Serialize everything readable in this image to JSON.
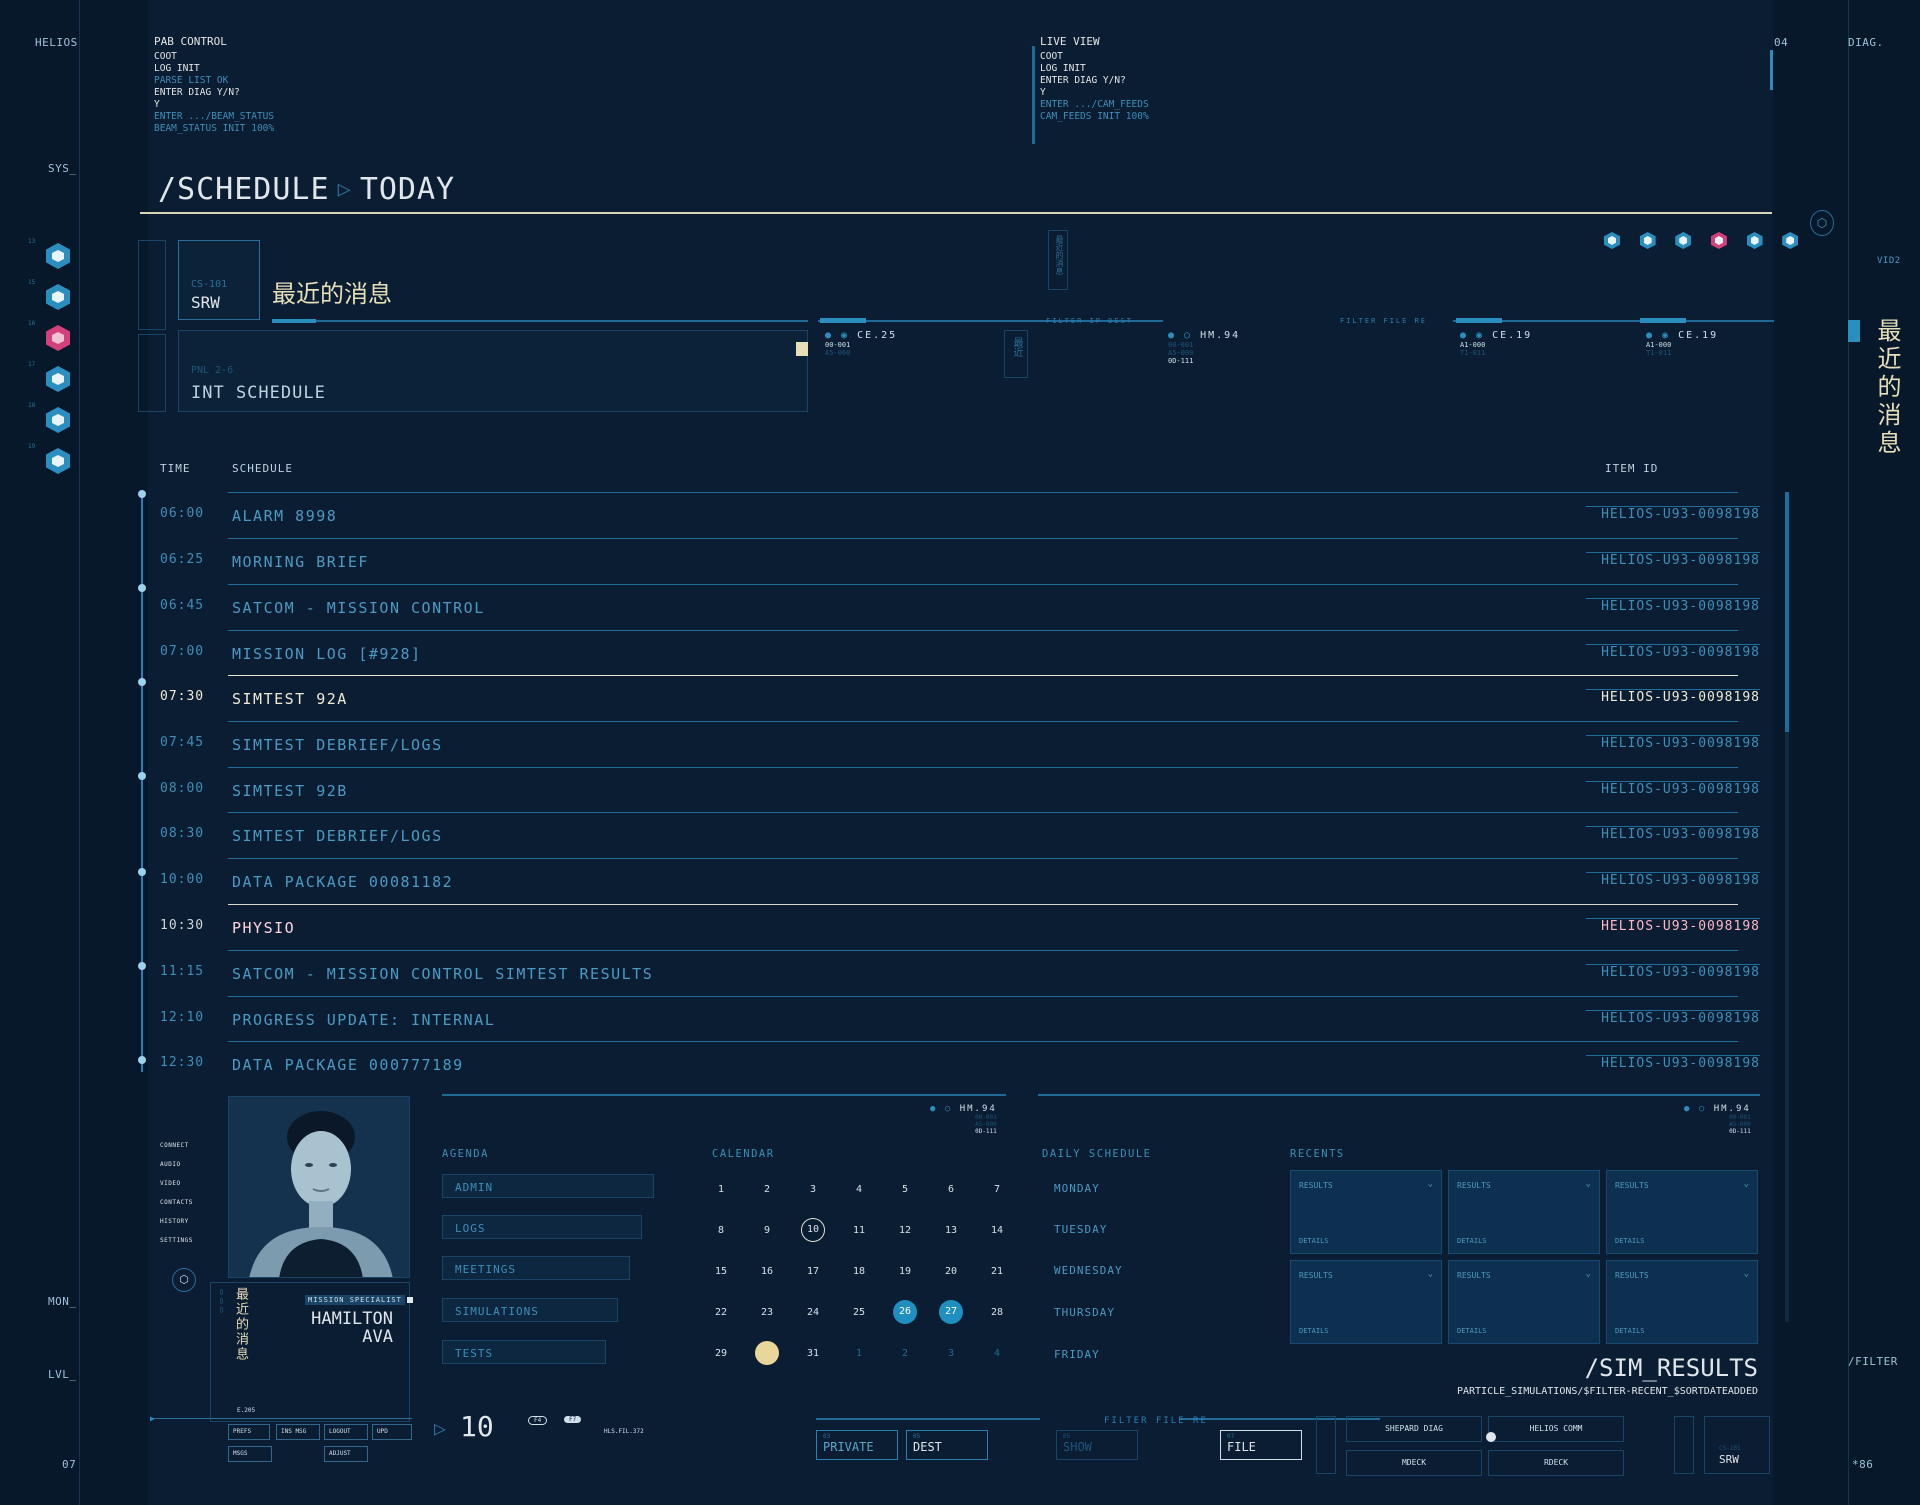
{
  "left_rail": {
    "brand": "HELIOS",
    "sys": "SYS_",
    "hex_nums": [
      "13",
      "15",
      "16",
      "17",
      "18",
      "19"
    ],
    "mon": "MON_",
    "lvl": "LVL_",
    "bottom": "07"
  },
  "right_rail": {
    "top_num": "04",
    "diag": "DIAG.",
    "vid": "VID2",
    "chinese": "最近的消息",
    "filter": "/FILTER",
    "bottom": "*86"
  },
  "terminal_left": {
    "title": "PAB CONTROL",
    "lines": [
      "COOT",
      "LOG INIT"
    ],
    "dim1": "PARSE LIST OK",
    "prompt": "ENTER DIAG Y/N?",
    "answer": "Y",
    "dim2": "ENTER .../BEAM_STATUS",
    "dim3": "BEAM_STATUS INIT 100%"
  },
  "terminal_right": {
    "title": "LIVE VIEW",
    "lines": [
      "COOT",
      "LOG INIT"
    ],
    "prompt": "ENTER DIAG Y/N?",
    "answer": "Y",
    "dim1": "ENTER .../CAM_FEEDS",
    "dim2": "CAM_FEEDS INIT 100%"
  },
  "header": {
    "title": "/SCHEDULE",
    "subtitle": "TODAY"
  },
  "card_srw": {
    "code": "CS-101",
    "name": "SRW",
    "message_title": "最近的消息"
  },
  "card_int": {
    "code": "PNL 2-6",
    "name": "INT SCHEDULE"
  },
  "vert_tags": {
    "tag_a": "最近的消息",
    "tag_b": "最近"
  },
  "status_blocks": [
    {
      "label": "CE.25",
      "l1": "00-001",
      "l2": "A5-000"
    },
    {
      "label": "HM.94",
      "l1": "00-001",
      "l2": "A5-000",
      "l3": "0D-111"
    },
    {
      "label": "CE.19",
      "l1": "A1-000",
      "l2": "T1-011"
    },
    {
      "label": "CE.19",
      "l1": "A1-000",
      "l2": "T1-011"
    }
  ],
  "filters": {
    "ip": "FILTER IP DEST",
    "file": "FILTER FILE RE"
  },
  "table": {
    "col_time": "TIME",
    "col_schedule": "SCHEDULE",
    "col_id": "ITEM ID",
    "rows": [
      {
        "time": "06:00",
        "name": "ALARM 8998",
        "id": "HELIOS-U93-0098198"
      },
      {
        "time": "06:25",
        "name": "MORNING BRIEF",
        "id": "HELIOS-U93-0098198"
      },
      {
        "time": "06:45",
        "name": "SATCOM - MISSION CONTROL",
        "id": "HELIOS-U93-0098198"
      },
      {
        "time": "07:00",
        "name": "MISSION LOG [#928]",
        "id": "HELIOS-U93-0098198"
      },
      {
        "time": "07:30",
        "name": "SIMTEST 92A",
        "id": "HELIOS-U93-0098198"
      },
      {
        "time": "07:45",
        "name": "SIMTEST DEBRIEF/LOGS",
        "id": "HELIOS-U93-0098198"
      },
      {
        "time": "08:00",
        "name": "SIMTEST 92B",
        "id": "HELIOS-U93-0098198"
      },
      {
        "time": "08:30",
        "name": "SIMTEST DEBRIEF/LOGS",
        "id": "HELIOS-U93-0098198"
      },
      {
        "time": "10:00",
        "name": "DATA PACKAGE 00081182",
        "id": "HELIOS-U93-0098198"
      },
      {
        "time": "10:30",
        "name": "PHYSIO",
        "id": "HELIOS-U93-0098198"
      },
      {
        "time": "11:15",
        "name": "SATCOM - MISSION CONTROL SIMTEST RESULTS",
        "id": "HELIOS-U93-0098198"
      },
      {
        "time": "12:10",
        "name": "PROGRESS UPDATE:  INTERNAL",
        "id": "HELIOS-U93-0098198"
      },
      {
        "time": "12:30",
        "name": "DATA PACKAGE 000777189",
        "id": "HELIOS-U93-0098198"
      }
    ]
  },
  "profile": {
    "menu": [
      "CONNECT",
      "AUDIO",
      "VIDEO",
      "CONTACTS",
      "HISTORY",
      "SETTINGS"
    ],
    "role": "MISSION SPECIALIST",
    "last_name": "HAMILTON",
    "first_name": "AVA",
    "chinese": "最近的消息",
    "code": "E.205",
    "buttons": [
      "PREFS",
      "INS MSG",
      "LOGOUT",
      "UPD",
      "MSGS",
      "ADJUST"
    ]
  },
  "agenda": {
    "label": "AGENDA",
    "items": [
      "ADMIN",
      "LOGS",
      "MEETINGS",
      "SIMULATIONS",
      "TESTS"
    ]
  },
  "calendar": {
    "label": "CALENDAR",
    "weeks": [
      [
        "1",
        "2",
        "3",
        "4",
        "5",
        "6",
        "7"
      ],
      [
        "8",
        "9",
        "10",
        "11",
        "12",
        "13",
        "14"
      ],
      [
        "15",
        "16",
        "17",
        "18",
        "19",
        "20",
        "21"
      ],
      [
        "22",
        "23",
        "24",
        "25",
        "26",
        "27",
        "28"
      ],
      [
        "29",
        "30",
        "31",
        "1",
        "2",
        "3",
        "4"
      ]
    ],
    "today": "10",
    "selected": [
      "26",
      "27"
    ]
  },
  "daily": {
    "label": "DAILY SCHEDULE",
    "days": [
      "MONDAY",
      "TUESDAY",
      "WEDNESDAY",
      "THURSDAY",
      "FRIDAY"
    ]
  },
  "recents": {
    "label": "RECENTS",
    "card_title": "RESULTS",
    "card_detail": "DETAILS"
  },
  "hm_tag": {
    "label": "HM.94",
    "l1": "00-001",
    "l2": "A5-000",
    "l3": "0D-111"
  },
  "sim_results": {
    "title": "/SIM_RESULTS",
    "path": "PARTICLE_SIMULATIONS/$FILTER-RECENT_$SORTDATEADDED"
  },
  "bottom_bar": {
    "counter": "10",
    "pill_a": "F4",
    "pill_b": "F7",
    "file_code": "HLS.FIL.372",
    "private_num": "03",
    "private": "PRIVATE",
    "dest_num": "05",
    "dest": "DEST",
    "filter": "FILTER FILE RE",
    "show_num": "05",
    "show": "SHOW",
    "file_num": "07",
    "file": "FILE",
    "shepard": "SHEPARD DIAG",
    "helios": "HELIOS COMM",
    "mdeck": "MDECK",
    "rdeck": "RDECK",
    "srw_code": "CS-101",
    "srw": "SRW"
  },
  "colors": {
    "background": "#07182a",
    "accent": "#2a8fbf",
    "highlight": "#e9e4cf",
    "alert": "#d4407c",
    "gold": "#e9d79a"
  }
}
